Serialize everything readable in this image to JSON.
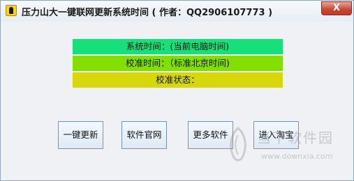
{
  "window": {
    "title": "压力山大一键联网更新系统时间 ( 作者：QQ2906107773 )",
    "close_label": "X"
  },
  "status": {
    "system_time": "系统时间：(当前电脑时间)",
    "calibrated_time": "校准时间：（标准北京时间)",
    "calibration_state": "校准状态："
  },
  "buttons": {
    "update": "一键更新",
    "official_site": "软件官网",
    "more_software": "更多软件",
    "taobao": "进入淘宝"
  },
  "watermark": {
    "title": "当下软件园",
    "url": "www.downxia.com"
  },
  "colors": {
    "system_time_bar": "#16e07a",
    "calibrated_time_bar": "#82df00",
    "calibration_state_bar": "#d7d70b",
    "close_button": "#c8462f"
  }
}
